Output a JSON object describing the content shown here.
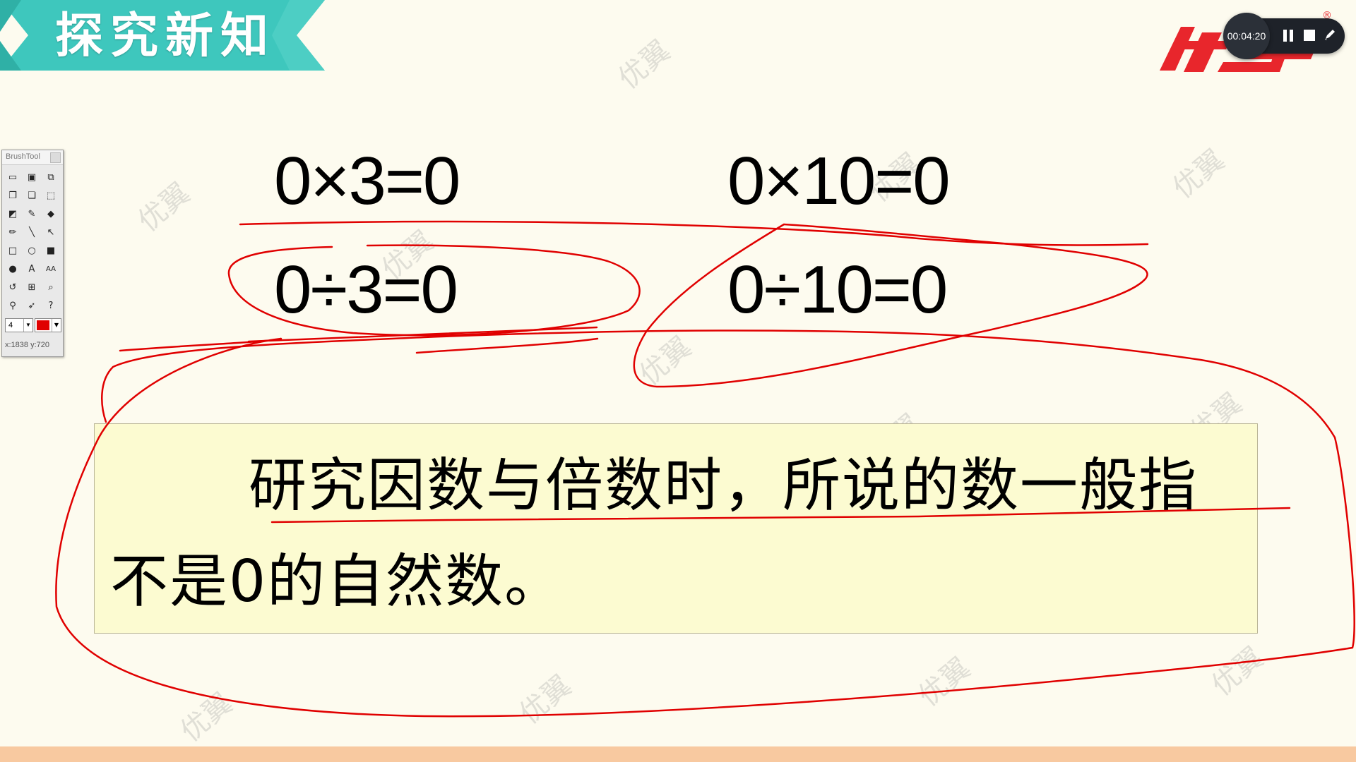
{
  "slide": {
    "title": "探究新知",
    "brand": "优翼",
    "registered_mark": "®",
    "equations": [
      "0×3=0",
      "0×10=0",
      "0÷3=0",
      "0÷10=0"
    ],
    "definition": "研究因数与倍数时，所说的数一般指不是0的自然数。",
    "watermark_text": "优翼"
  },
  "recorder": {
    "elapsed": "00:04:20",
    "pause_icon": "pause-icon",
    "stop_icon": "stop-icon",
    "pen_icon": "pen-icon"
  },
  "brush_tool": {
    "title": "BrushTool",
    "line_width": "4",
    "color": "#e00000",
    "coords": "x:1838 y:720",
    "tools": [
      "open-icon",
      "save-icon",
      "screenshot-icon",
      "copy-icon",
      "paste-icon",
      "select-icon",
      "eraser-icon",
      "eyedropper-icon",
      "fill-icon",
      "pencil-icon",
      "line-icon",
      "arrow-icon",
      "rectangle-icon",
      "ellipse-icon",
      "filled-rectangle-icon",
      "filled-ellipse-icon",
      "text-icon",
      "font-size-icon",
      "undo-icon",
      "grid-icon",
      "zoom-icon",
      "pin-icon",
      "pointer-icon",
      "help-icon"
    ]
  },
  "colors": {
    "banner": "#3ec7bd",
    "brand_red": "#e8262c",
    "ink": "#e00000",
    "slide_bg": "#fdfbef",
    "box_bg": "#fcfbd1",
    "bottom_bar": "#f8c9a0"
  }
}
